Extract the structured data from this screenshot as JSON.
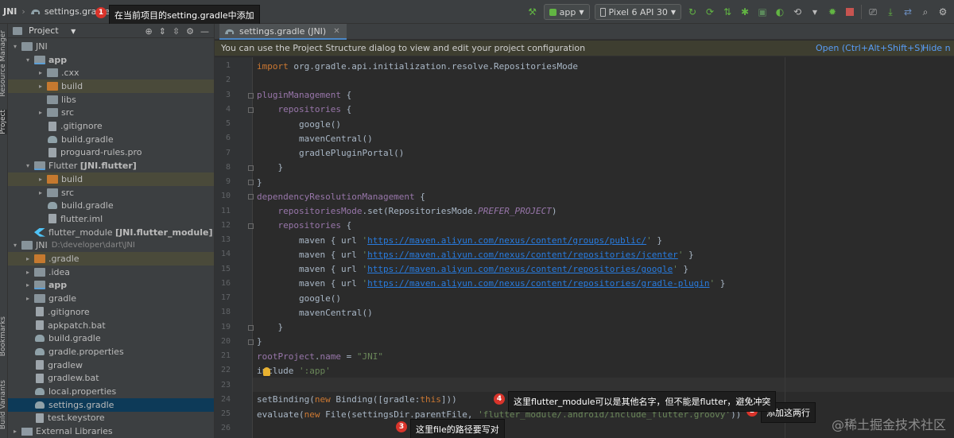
{
  "nav": {
    "project": "JNI",
    "file": "settings.gradle",
    "annotation_1": "1",
    "annotation_1_text": "在当前项目的setting.gradle中添加"
  },
  "toolbar": {
    "run_config": "app",
    "device": "Pixel 6 API 30"
  },
  "left_strip": {
    "resource_manager": "Resource Manager",
    "project": "Project",
    "bookmarks": "Bookmarks",
    "build_variants": "Build Variants"
  },
  "project_panel": {
    "title": "Project",
    "tree": [
      {
        "label": "JNI",
        "depth": 0,
        "arrow": "▾",
        "icon": "folder"
      },
      {
        "label": "app",
        "depth": 1,
        "arrow": "▾",
        "icon": "folder-module",
        "bold": true
      },
      {
        "label": ".cxx",
        "depth": 2,
        "arrow": "▸",
        "icon": "folder"
      },
      {
        "label": "build",
        "depth": 2,
        "arrow": "▸",
        "icon": "folder-orange",
        "highlight": true
      },
      {
        "label": "libs",
        "depth": 2,
        "arrow": "",
        "icon": "folder"
      },
      {
        "label": "src",
        "depth": 2,
        "arrow": "▸",
        "icon": "folder"
      },
      {
        "label": ".gitignore",
        "depth": 2,
        "arrow": "",
        "icon": "file"
      },
      {
        "label": "build.gradle",
        "depth": 2,
        "arrow": "",
        "icon": "gradle"
      },
      {
        "label": "proguard-rules.pro",
        "depth": 2,
        "arrow": "",
        "icon": "file"
      },
      {
        "label": "Flutter [JNI.flutter]",
        "depth": 1,
        "arrow": "▾",
        "icon": "folder-module"
      },
      {
        "label": "build",
        "depth": 2,
        "arrow": "▸",
        "icon": "folder-orange",
        "highlight": true
      },
      {
        "label": "src",
        "depth": 2,
        "arrow": "▸",
        "icon": "folder"
      },
      {
        "label": "build.gradle",
        "depth": 2,
        "arrow": "",
        "icon": "gradle"
      },
      {
        "label": "flutter.iml",
        "depth": 2,
        "arrow": "",
        "icon": "file"
      },
      {
        "label": "flutter_module [JNI.flutter_module]",
        "depth": 1,
        "arrow": "",
        "icon": "flutter"
      },
      {
        "label": "JNI",
        "depth": 0,
        "arrow": "▾",
        "icon": "folder",
        "suffix": "D:\\developer\\dart\\JNI"
      },
      {
        "label": ".gradle",
        "depth": 1,
        "arrow": "▸",
        "icon": "folder-orange",
        "highlight": true
      },
      {
        "label": ".idea",
        "depth": 1,
        "arrow": "▸",
        "icon": "folder"
      },
      {
        "label": "app",
        "depth": 1,
        "arrow": "▸",
        "icon": "folder-module",
        "bold": true
      },
      {
        "label": "gradle",
        "depth": 1,
        "arrow": "▸",
        "icon": "folder"
      },
      {
        "label": ".gitignore",
        "depth": 1,
        "arrow": "",
        "icon": "file"
      },
      {
        "label": "apkpatch.bat",
        "depth": 1,
        "arrow": "",
        "icon": "file"
      },
      {
        "label": "build.gradle",
        "depth": 1,
        "arrow": "",
        "icon": "gradle"
      },
      {
        "label": "gradle.properties",
        "depth": 1,
        "arrow": "",
        "icon": "gradle"
      },
      {
        "label": "gradlew",
        "depth": 1,
        "arrow": "",
        "icon": "file"
      },
      {
        "label": "gradlew.bat",
        "depth": 1,
        "arrow": "",
        "icon": "file"
      },
      {
        "label": "local.properties",
        "depth": 1,
        "arrow": "",
        "icon": "gradle"
      },
      {
        "label": "settings.gradle",
        "depth": 1,
        "arrow": "",
        "icon": "gradle",
        "selected": true
      },
      {
        "label": "test.keystore",
        "depth": 1,
        "arrow": "",
        "icon": "file"
      },
      {
        "label": "External Libraries",
        "depth": 0,
        "arrow": "▸",
        "icon": "lib"
      }
    ]
  },
  "editor": {
    "tab_label": "settings.gradle (JNI)",
    "notice": "You can use the Project Structure dialog to view and edit your project configuration",
    "notice_open": "Open (Ctrl+Alt+Shift+S)",
    "notice_hide": "Hide n",
    "lines": [
      {
        "n": "1",
        "parts": [
          [
            "kw",
            "import "
          ],
          [
            "",
            "org.gradle.api.initialization.resolve.RepositoriesMode"
          ]
        ]
      },
      {
        "n": "2",
        "parts": []
      },
      {
        "n": "3",
        "parts": [
          [
            "prop",
            "pluginManagement"
          ],
          [
            "",
            " {"
          ]
        ]
      },
      {
        "n": "4",
        "parts": [
          [
            "",
            "    "
          ],
          [
            "prop",
            "repositories"
          ],
          [
            "",
            " {"
          ]
        ]
      },
      {
        "n": "5",
        "parts": [
          [
            "",
            "        google()"
          ]
        ]
      },
      {
        "n": "6",
        "parts": [
          [
            "",
            "        mavenCentral()"
          ]
        ]
      },
      {
        "n": "7",
        "parts": [
          [
            "",
            "        gradlePluginPortal()"
          ]
        ]
      },
      {
        "n": "8",
        "parts": [
          [
            "",
            "    }"
          ]
        ]
      },
      {
        "n": "9",
        "parts": [
          [
            "",
            "}"
          ]
        ]
      },
      {
        "n": "10",
        "parts": [
          [
            "prop",
            "dependencyResolutionManagement"
          ],
          [
            "",
            " {"
          ]
        ]
      },
      {
        "n": "11",
        "parts": [
          [
            "",
            "    "
          ],
          [
            "prop",
            "repositoriesMode"
          ],
          [
            "",
            ".set(RepositoriesMode."
          ],
          [
            "itl",
            "PREFER_PROJECT"
          ],
          [
            "",
            ")"
          ]
        ]
      },
      {
        "n": "12",
        "parts": [
          [
            "",
            "    "
          ],
          [
            "prop",
            "repositories"
          ],
          [
            "",
            " {"
          ]
        ]
      },
      {
        "n": "13",
        "parts": [
          [
            "",
            "        maven { url "
          ],
          [
            "str",
            "'"
          ],
          [
            "url",
            "https://maven.aliyun.com/nexus/content/groups/public/"
          ],
          [
            "str",
            "'"
          ],
          [
            "",
            " }"
          ]
        ]
      },
      {
        "n": "14",
        "parts": [
          [
            "",
            "        maven { url "
          ],
          [
            "str",
            "'"
          ],
          [
            "url",
            "https://maven.aliyun.com/nexus/content/repositories/jcenter"
          ],
          [
            "str",
            "'"
          ],
          [
            "",
            " }"
          ]
        ]
      },
      {
        "n": "15",
        "parts": [
          [
            "",
            "        maven { url "
          ],
          [
            "str",
            "'"
          ],
          [
            "url",
            "https://maven.aliyun.com/nexus/content/repositories/google"
          ],
          [
            "str",
            "'"
          ],
          [
            "",
            " }"
          ]
        ]
      },
      {
        "n": "16",
        "parts": [
          [
            "",
            "        maven { url "
          ],
          [
            "str",
            "'"
          ],
          [
            "url",
            "https://maven.aliyun.com/nexus/content/repositories/gradle-plugin"
          ],
          [
            "str",
            "'"
          ],
          [
            "",
            " }"
          ]
        ]
      },
      {
        "n": "17",
        "parts": [
          [
            "",
            "        google()"
          ]
        ]
      },
      {
        "n": "18",
        "parts": [
          [
            "",
            "        mavenCentral()"
          ]
        ]
      },
      {
        "n": "19",
        "parts": [
          [
            "",
            "    }"
          ]
        ]
      },
      {
        "n": "20",
        "parts": [
          [
            "",
            "}"
          ]
        ]
      },
      {
        "n": "21",
        "parts": [
          [
            "prop",
            "rootProject"
          ],
          [
            "",
            "."
          ],
          [
            "prop",
            "name"
          ],
          [
            "",
            " = "
          ],
          [
            "str",
            "\"JNI\""
          ]
        ]
      },
      {
        "n": "22",
        "parts": [
          [
            "",
            "include "
          ],
          [
            "str",
            "':app'"
          ]
        ]
      },
      {
        "n": "23",
        "parts": []
      },
      {
        "n": "24",
        "parts": [
          [
            "",
            "setBinding("
          ],
          [
            "kw",
            "new "
          ],
          [
            "",
            "Binding([gradle:"
          ],
          [
            "kw",
            "this"
          ],
          [
            "",
            "]))"
          ]
        ]
      },
      {
        "n": "25",
        "parts": [
          [
            "",
            "evaluate("
          ],
          [
            "kw",
            "new "
          ],
          [
            "",
            "File(settingsDir.parentFile, "
          ],
          [
            "str",
            "'flutter_module/.android/include_flutter.groovy'"
          ],
          [
            "",
            "))"
          ]
        ]
      },
      {
        "n": "26",
        "parts": []
      }
    ]
  },
  "annotations": {
    "a2_num": "2",
    "a2_text": "添加这两行",
    "a3_num": "3",
    "a3_text": "这里file的路径要写对",
    "a4_num": "4",
    "a4_text": "这里flutter_module可以是其他名字，但不能是flutter，避免冲突"
  },
  "watermark": "@稀土掘金技术社区",
  "colors": {
    "background": "#2b2b2b",
    "panel": "#3c3f41",
    "keyword": "#cc7832",
    "string": "#6a8759",
    "url": "#287bde",
    "property": "#9876aa",
    "badge": "#d9342b"
  }
}
